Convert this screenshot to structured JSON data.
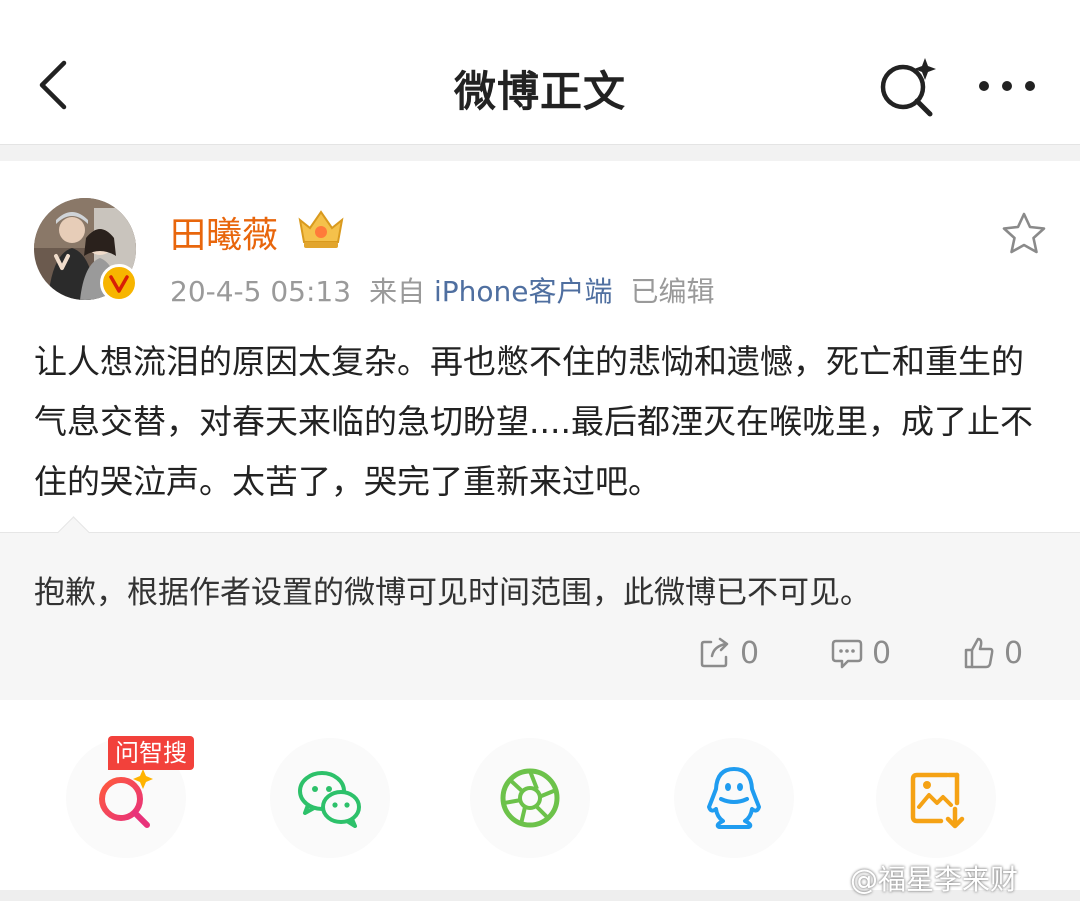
{
  "header": {
    "title": "微博正文",
    "back_icon": "chevron-left-icon",
    "search_icon": "sparkle-search-icon",
    "more_icon": "more-dots-icon"
  },
  "post": {
    "author": "田曦薇",
    "author_color": "#e8660c",
    "timestamp": "20-4-5 05:13",
    "source_prefix": "来自",
    "source": "iPhone客户端",
    "edited_label": "已编辑",
    "body": "让人想流泪的原因太复杂。再也憋不住的悲恸和遗憾，死亡和重生的气息交替，对春天来临的急切盼望....最后都湮灭在喉咙里，成了止不住的哭泣声。太苦了，哭完了重新来过吧。",
    "favorite_icon": "star-outline-icon"
  },
  "notice": {
    "text": "抱歉，根据作者设置的微博可见时间范围，此微博已不可见。"
  },
  "stats": {
    "reposts": "0",
    "comments": "0",
    "likes": "0"
  },
  "share": {
    "ai_search_tag": "问智搜",
    "items": [
      "ai-search-icon",
      "wechat-icon",
      "moments-icon",
      "qq-icon",
      "save-image-icon"
    ]
  },
  "watermark": "@福星李来财"
}
